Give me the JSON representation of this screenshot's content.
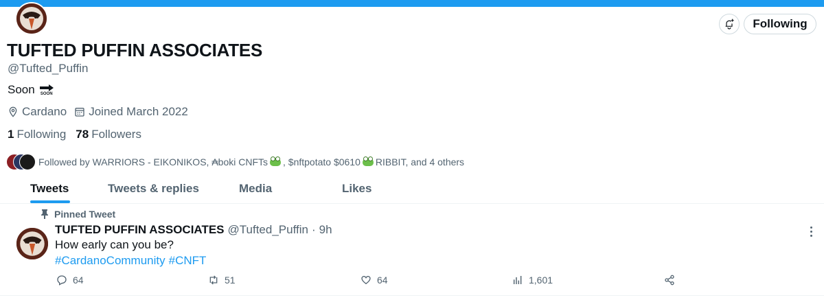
{
  "profile": {
    "display_name": "TUFTED PUFFIN ASSOCIATES",
    "handle": "@Tufted_Puffin",
    "bio": "Soon",
    "bio_emoji_text": "SOON",
    "location": "Cardano",
    "joined": "Joined March 2022",
    "following_count": "1",
    "following_label": "Following",
    "followers_count": "78",
    "followers_label": "Followers",
    "followed_by": "Followed by WARRIORS - EIKONIKOS, ₳boki CNFTs",
    "followed_by_mid": ", $nftpotato $0610",
    "followed_by_end": "RIBBIT, and 4 others"
  },
  "header_actions": {
    "notify_icon": "bell-plus-icon",
    "following_button": "Following"
  },
  "tabs": [
    {
      "label": "Tweets",
      "active": true
    },
    {
      "label": "Tweets & replies",
      "active": false
    },
    {
      "label": "Media",
      "active": false
    },
    {
      "label": "Likes",
      "active": false
    }
  ],
  "pinned_tweet": {
    "pinned_label": "Pinned Tweet",
    "author_name": "TUFTED PUFFIN ASSOCIATES",
    "author_handle": "@Tufted_Puffin",
    "separator": "·",
    "time": "9h",
    "text": "How early can you be?",
    "hashtags": [
      "#CardanoCommunity",
      "#CNFT"
    ],
    "stats": {
      "replies": "64",
      "retweets": "51",
      "likes": "64",
      "views": "1,601"
    }
  },
  "colors": {
    "accent": "#1d9bf0",
    "text": "#0f1419",
    "muted": "#536471",
    "avatar_bg": "#5a2418"
  }
}
